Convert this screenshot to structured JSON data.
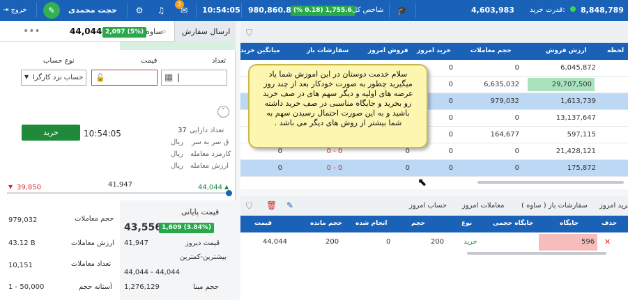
{
  "topbar": {
    "exit_label": "خروج",
    "user_name": "حجت محمدی",
    "notification_count": "2",
    "time": "10:54:05",
    "index_value": "980,860.8",
    "index_change": "1,755.6",
    "index_percent": "(% 0.18)",
    "index_label": "شاخص کل",
    "buying_power": "4,603,983",
    "buying_power_label": "قدرت خرید:",
    "account_value": "8,848,789"
  },
  "order": {
    "tab_label": "ارسال سفارش",
    "symbol": "ساوه",
    "symbol_change": "2,097 (5%)",
    "symbol_price": "44,044",
    "account_type_label": "نوع حساب",
    "account_type_value": "حساب نزد کارگزا",
    "price_label": "قیمت",
    "quantity_label": "تعداد",
    "time": "10:54:05",
    "buy_label": "خرید",
    "asset_count_label": "تعداد دارایی",
    "asset_count_value": "37",
    "head_to_head_label": "ق سر به سر",
    "head_to_head_value": "ریال",
    "commission_label": "کارمزد معامله",
    "commission_value": "ریال",
    "trade_value_label": "ارزش معامله",
    "trade_value_value": "ریال",
    "range_low": "39,850",
    "range_mid": "41,947",
    "range_high": "44,044"
  },
  "stats": {
    "final_price_label": "قیمت پایانی",
    "final_price": "43,556",
    "final_change": "1,609 (3.84%)",
    "volume_label": "حجم معاملات",
    "volume": "979,032",
    "yesterday_price_label": "قیمت دیروز",
    "yesterday_price": "41,947",
    "trade_value_label": "ارزش معاملات",
    "trade_value": "43.12 B",
    "max_min_label": "بیشترین-کمترین",
    "max_min": "44,044 - 44,044",
    "trade_count_label": "تعداد معاملات",
    "trade_count": "10,151",
    "base_volume_label": "حجم مبنا",
    "base_volume": "1,276,129",
    "volume_threshold_label": "آستانه حجم",
    "volume_threshold": "1 - 50,000"
  },
  "market_table": {
    "headers": [
      "لحظه",
      "ارزش فروش",
      "حجم معاملات",
      "خرید امروز",
      "فروش امروز",
      "سفارشات باز",
      "میانگین خرید"
    ],
    "rows": [
      [
        "",
        "6,045,872",
        "0",
        "0",
        "",
        "",
        ""
      ],
      [
        "",
        "29,707,500",
        "6,635,032",
        "0",
        "",
        "",
        ""
      ],
      [
        "",
        "1,613,739",
        "979,032",
        "0",
        "",
        "",
        ""
      ],
      [
        "",
        "13,137,647",
        "0",
        "0",
        "",
        "",
        ""
      ],
      [
        "",
        "597,115",
        "164,677",
        "0",
        "",
        "",
        ""
      ],
      [
        "",
        "21,428,121",
        "0",
        "0",
        "0",
        "0 - 0",
        "0"
      ],
      [
        "",
        "175,872",
        "0",
        "0",
        "0",
        "0 - 0",
        "0"
      ]
    ]
  },
  "tooltip": {
    "text": "سلام خدمت دوستان در این اموزش شما یاد میگیرید چطور به صورت خودکار بعد از چند روز عرضه های اولیه و دیگر سهم های در صف خرید رو بخرید و جایگاه مناسبی در صف خرید داشته باشید و به این صورت احتمال رسیدن سهم به شما بیشتر از روش های دیگر می باشد ."
  },
  "orders_panel": {
    "tabs": [
      "خرید امروز",
      "سفارشات باز ( ساوه )",
      "معاملات امروز",
      "حساب امروز"
    ],
    "headers": [
      "حذف",
      "جایگاه",
      "جایگاه حجمی",
      "نوع",
      "حجم",
      "انجام شده",
      "حجم مانده",
      "قیمت"
    ],
    "row": {
      "delete": "✕",
      "position": "596",
      "volume_position": "",
      "type": "خرید",
      "volume": "200",
      "done": "0",
      "remaining": "200",
      "price": "44,044"
    }
  },
  "icons": {
    "filter": "filter-icon",
    "trash": "trash-icon",
    "edit": "pencil-icon",
    "search": "search-icon",
    "more": "more-icon"
  },
  "colors": {
    "topbar": "#1a62b8",
    "buy_green": "#1f8b3a",
    "sell_red": "#d32f2f",
    "highlight_row": "#bcd8f5"
  }
}
